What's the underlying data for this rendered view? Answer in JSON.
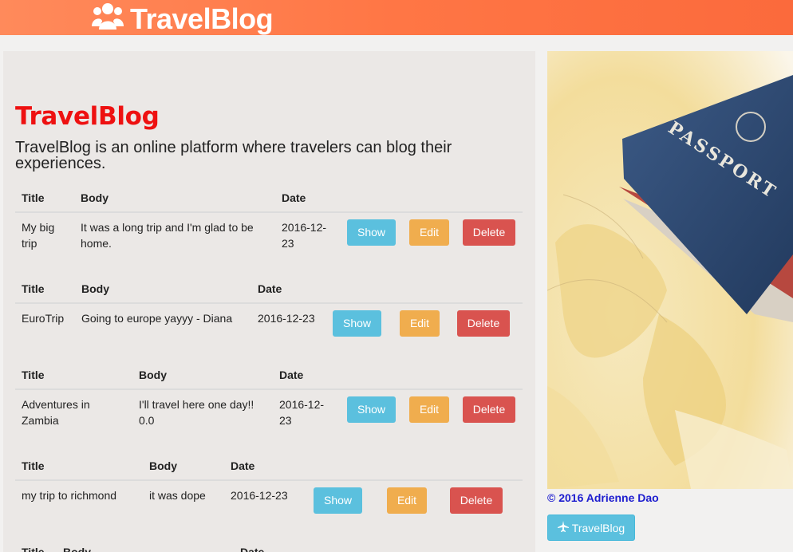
{
  "navbar": {
    "brand": "TravelBlog",
    "brand_icon": "users-icon"
  },
  "hero": {
    "title": "TravelBlog",
    "description": "TravelBlog is an online platform where travelers can blog their experiences."
  },
  "table_headers": {
    "title": "Title",
    "body": "Body",
    "date": "Date"
  },
  "buttons": {
    "show": "Show",
    "edit": "Edit",
    "delete": "Delete"
  },
  "posts": [
    {
      "title": "My big trip",
      "body": "It was a long trip and I'm glad to be home.",
      "date": "2016-12-23"
    },
    {
      "title": "EuroTrip",
      "body": "Going to europe yayyy - Diana",
      "date": "2016-12-23"
    },
    {
      "title": "Adventures in Zambia",
      "body": "I'll travel here one day!! 0.0",
      "date": "2016-12-23"
    },
    {
      "title": "my trip to richmond",
      "body": "it was dope",
      "date": "2016-12-23"
    }
  ],
  "sidebar": {
    "image_alt": "passport-on-map-photo",
    "copyright": "© 2016 Adrienne Dao",
    "button_label": "TravelBlog",
    "button_icon": "plane-icon"
  },
  "colors": {
    "navbar": "#ff7645",
    "hero_title": "#ee1111",
    "show": "#5bc0de",
    "edit": "#f0ad4e",
    "delete": "#d9534f",
    "copyright": "#1d1dcf"
  }
}
